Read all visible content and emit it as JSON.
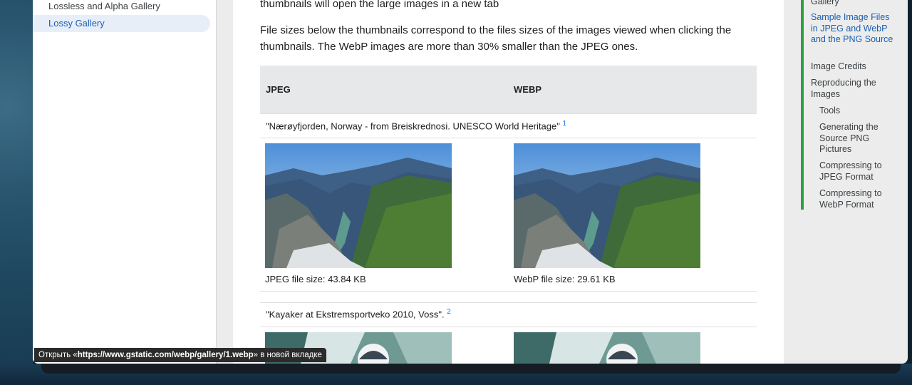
{
  "nav": {
    "items": [
      {
        "label": "Lossless and Alpha Gallery",
        "active": false
      },
      {
        "label": "Lossy Gallery",
        "active": true
      }
    ]
  },
  "content": {
    "intro_partial": "thumbnails will open the large images in a new tab",
    "file_size_note": "File sizes below the thumbnails correspond to the files sizes of the images viewed when clicking the thumbnails. The WebP images are more than 30% smaller than the JPEG ones.",
    "table": {
      "headers": [
        "JPEG",
        "WEBP"
      ],
      "rows": [
        {
          "caption": "\"Nærøyfjorden, Norway - from Breiskrednosi. UNESCO World Heritage\"",
          "footnote": "1",
          "jpeg_size": "JPEG file size: 43.84 KB",
          "webp_size": "WebP file size: 29.61 KB"
        },
        {
          "caption": "\"Kayaker at Ekstremsportveko 2010, Voss\".",
          "footnote": "2"
        }
      ]
    }
  },
  "toc": {
    "items": [
      {
        "label": "Gallery",
        "active": false,
        "indent": 0
      },
      {
        "label": "Sample Image Files in JPEG and WebP and the PNG Source",
        "active": true,
        "indent": 0
      },
      {
        "label": "Image Credits",
        "active": false,
        "indent": 0
      },
      {
        "label": "Reproducing the Images",
        "active": false,
        "indent": 0
      },
      {
        "label": "Tools",
        "active": false,
        "indent": 1
      },
      {
        "label": "Generating the Source PNG Pictures",
        "active": false,
        "indent": 1
      },
      {
        "label": "Compressing to JPEG Format",
        "active": false,
        "indent": 1
      },
      {
        "label": "Compressing to WebP Format",
        "active": false,
        "indent": 1
      }
    ]
  },
  "status_bar": {
    "prefix": "Открыть «",
    "url": "https://www.gstatic.com/webp/gallery/1.webp",
    "suffix": "» в новой вкладке"
  },
  "colors": {
    "accent": "#1a5fb4",
    "toc_bar": "#2e9e44",
    "table_header_bg": "#e7e8ea"
  }
}
